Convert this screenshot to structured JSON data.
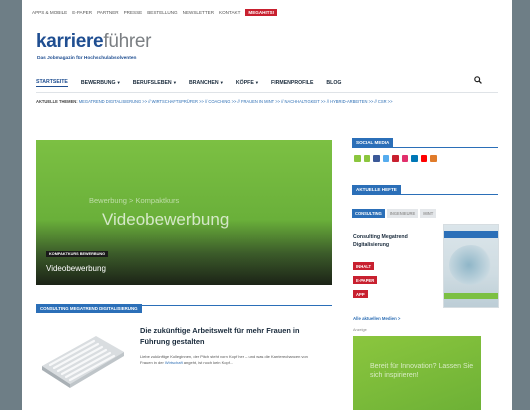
{
  "utility": {
    "links": [
      "APPS & MOBILE",
      "E-PAPER",
      "PARTNER",
      "PRESSE",
      "BESTELLUNG",
      "NEWSLETTER",
      "KONTAKT"
    ],
    "highlight": "MEGAHITS!"
  },
  "brand": {
    "logo_a": "karriere",
    "logo_b": "führer",
    "tagline": "Das Jobmagazin für Hochschulabsolventen"
  },
  "nav": {
    "items": [
      "STARTSEITE",
      "BEWERBUNG",
      "BERUFSLEBEN",
      "BRANCHEN",
      "KÖPFE",
      "FIRMENPROFILE",
      "BLOG"
    ],
    "chevron": "▾",
    "search_icon": "search-icon"
  },
  "topics": {
    "label": "AKTUELLE THEMEN:",
    "items": "MEGATREND DIGITALISIERUNG >> // WIRTSCHAFTSPRÜFER >> // COACHING >> // FRAUEN IN MINT >> // NACHHALTIGKEIT >> // HYBRID-ARBEITEN >> // CSR >>"
  },
  "hero": {
    "crumb": "Bewerbung > Kompaktkurs",
    "big": "Videobewerbung",
    "badge": "KOMPAKTKURS BEWERBUNG",
    "title": "Videobewerbung"
  },
  "section": {
    "label": "CONSULTING MEGATREND DIGITALISIERUNG"
  },
  "article": {
    "title": "Die zukünftige Arbeitswelt für mehr Frauen in Führung gestalten",
    "excerpt_a": "Liebe zukünftige Kolleginnen, der Pitch steht vorn Kopf her – und was die Karrierechancen von Frauen in der ",
    "excerpt_link": "Wirtschaft",
    "excerpt_b": " angeht, ist noch kein Kopf..."
  },
  "sidebar": {
    "social_label": "SOCIAL MEDIA",
    "social_colors": [
      "#8bc63e",
      "#8bc63e",
      "#3b5998",
      "#55acee",
      "#c8202f",
      "#e1306c",
      "#0077b5",
      "#ff0000",
      "#e07b2a"
    ],
    "issues_label": "AKTUELLE HEFTE",
    "tabs": [
      "CONSULTING",
      "INGENIEURE",
      "MINT"
    ],
    "mag_title": "Consulting Megatrend Digitalisierung",
    "buttons": [
      "INHALT",
      "E-PAPER",
      "APP"
    ],
    "all_link": "Alle aktuellen Medien >",
    "ad_label": "Anzeige",
    "ad_text": "Bereit für Innovation? Lassen Sie sich inspirieren!"
  }
}
